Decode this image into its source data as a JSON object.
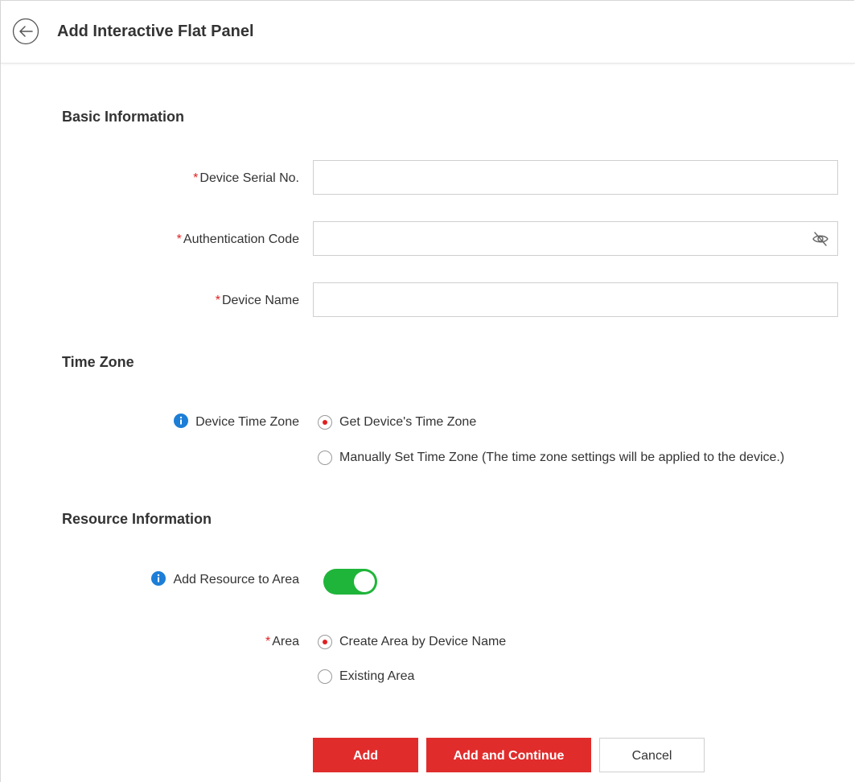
{
  "header": {
    "title": "Add Interactive Flat Panel",
    "back_icon": "back-arrow-circle-icon"
  },
  "sections": {
    "basic_info": "Basic Information",
    "time_zone": "Time Zone",
    "resource_info": "Resource Information"
  },
  "fields": {
    "required_mark": "*",
    "serial_no": {
      "label": "Device Serial No.",
      "value": "",
      "placeholder": ""
    },
    "auth_code": {
      "label": "Authentication Code",
      "value": "",
      "placeholder": "",
      "toggle_icon": "eye-hidden-icon"
    },
    "device_name": {
      "label": "Device Name",
      "value": "",
      "placeholder": ""
    }
  },
  "time_zone": {
    "label": "Device Time Zone",
    "info_icon": "info-icon",
    "options": [
      {
        "label": "Get Device's Time Zone",
        "checked": true
      },
      {
        "label": "Manually Set Time Zone (The time zone settings will be applied to the device.)",
        "checked": false
      }
    ]
  },
  "resource": {
    "add_to_area_label": "Add Resource to Area",
    "add_to_area_enabled": true,
    "area_label": "Area",
    "area_options": [
      {
        "label": "Create Area by Device Name",
        "checked": true
      },
      {
        "label": "Existing Area",
        "checked": false
      }
    ]
  },
  "buttons": {
    "add": "Add",
    "add_continue": "Add and Continue",
    "cancel": "Cancel"
  },
  "colors": {
    "accent_red": "#e12c2c",
    "required_red": "#e02020",
    "toggle_green": "#1fb53a",
    "info_blue": "#1c7ed6"
  }
}
